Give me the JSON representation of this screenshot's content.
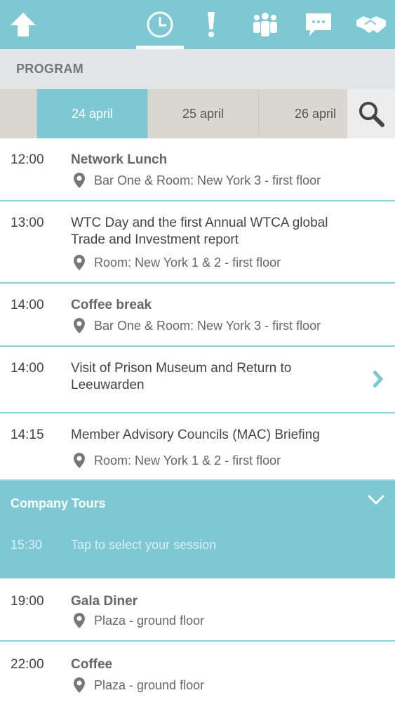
{
  "nav": {
    "icons": [
      "home-icon",
      "clock-icon",
      "alert-icon",
      "people-icon",
      "chat-icon",
      "handshake-icon"
    ],
    "active": "clock-icon"
  },
  "section": {
    "title": "PROGRAM"
  },
  "dates": {
    "d1": "24 april",
    "d2": "25 april",
    "d3": "26 april",
    "active": "24 april"
  },
  "events": [
    {
      "time": "12:00",
      "title": "Network Lunch",
      "location": "Bar One & Room: New York 3 - first floor"
    },
    {
      "time": "13:00",
      "title": "WTC Day and the first Annual WTCA global Trade and Investment report",
      "location": "Room: New York 1 & 2 - first floor"
    },
    {
      "time": "14:00",
      "title": "Coffee break",
      "location": "Bar One & Room: New York 3 - first floor"
    },
    {
      "time": "14:00",
      "title": "Visit of Prison Museum and Return to Leeuwarden",
      "location": ""
    },
    {
      "time": "14:15",
      "title": "Member Advisory Councils (MAC) Briefing",
      "location": "Room: New York 1 & 2 - first floor"
    }
  ],
  "group": {
    "title": "Company Tours",
    "time": "15:30",
    "text": "Tap to select your session"
  },
  "events2": [
    {
      "time": "19:00",
      "title": "Gala Diner",
      "location": "Plaza - ground floor"
    },
    {
      "time": "22:00",
      "title": "Coffee",
      "location": "Plaza - ground floor"
    }
  ],
  "colors": {
    "accent": "#7ec8d4",
    "divider": "#8fd0da"
  }
}
